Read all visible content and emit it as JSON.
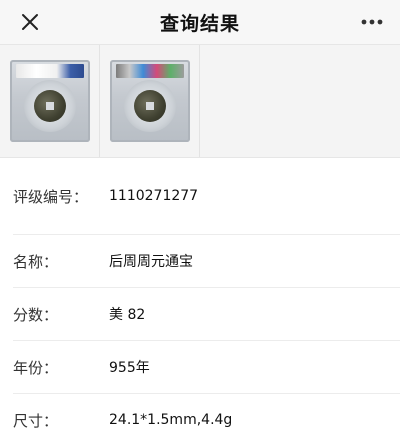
{
  "header": {
    "title": "查询结果",
    "close_icon": "close-icon",
    "more_icon": "more-horizontal-icon"
  },
  "thumbnails": [
    {
      "name": "coin-photo-front",
      "label_style": "white-blue"
    },
    {
      "name": "coin-photo-back",
      "label_style": "holographic"
    }
  ],
  "fields": [
    {
      "label": "评级编号：",
      "value": "1110271277"
    },
    {
      "label": "名称：",
      "value": "后周周元通宝"
    },
    {
      "label": "分数：",
      "value": "美 82"
    },
    {
      "label": "年份：",
      "value": "955年"
    },
    {
      "label": "尺寸：",
      "value": "24.1*1.5mm,4.4g"
    }
  ],
  "colors": {
    "header_bg": "#f7f7f7",
    "thumb_strip_bg": "#f4f4f4",
    "divider": "#ececec"
  }
}
